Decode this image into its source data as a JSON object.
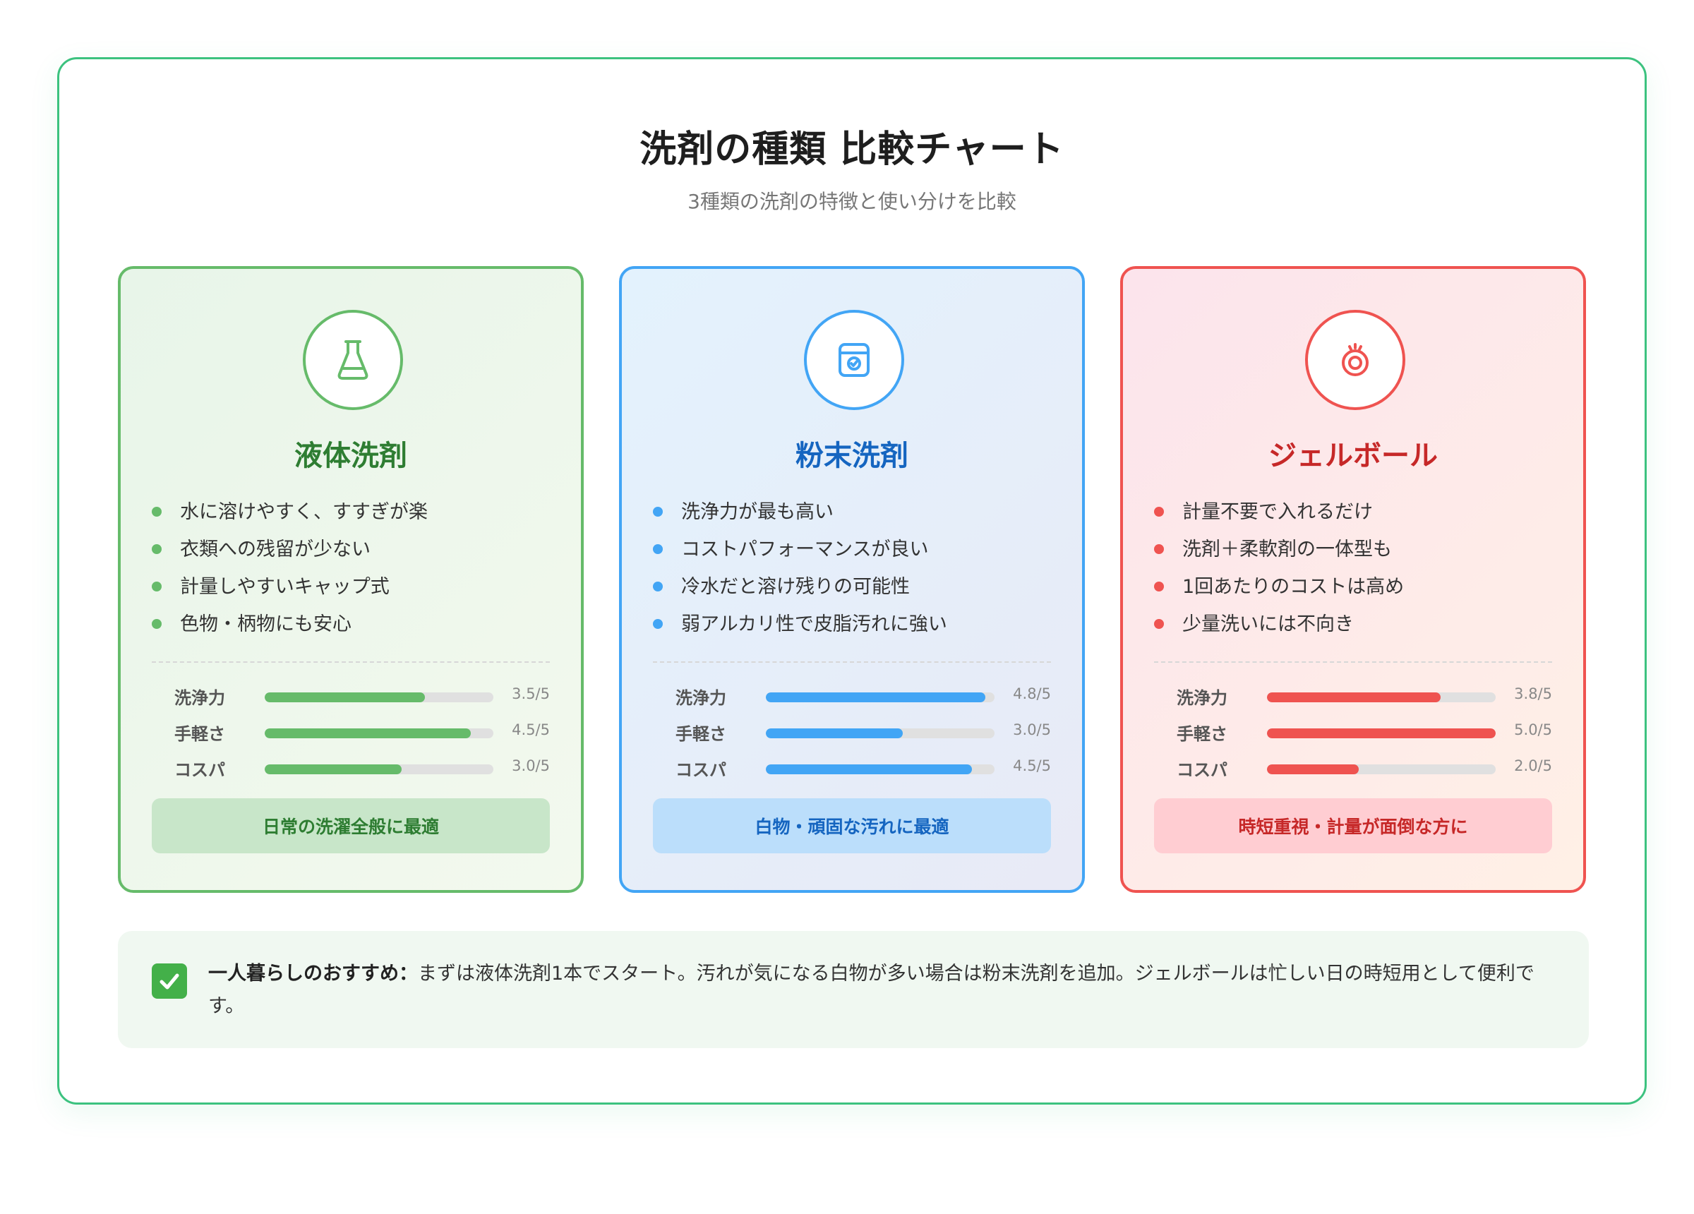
{
  "header": {
    "title": "洗剤の種類 比較チャート",
    "subtitle": "3種類の洗剤の特徴と使い分けを比較"
  },
  "colors": {
    "frame_border": "#3cc27f",
    "green": "#66bb6a",
    "blue": "#42a5f5",
    "red": "#ef5350"
  },
  "cards": [
    {
      "icon": "flask-icon",
      "title": "液体洗剤",
      "features": [
        "水に溶けやすく、すすぎが楽",
        "衣類への残留が少ない",
        "計量しやすいキャップ式",
        "色物・柄物にも安心"
      ],
      "ratings": [
        {
          "label": "洗浄力",
          "value": 3.5,
          "display": "3.5/5"
        },
        {
          "label": "手軽さ",
          "value": 4.5,
          "display": "4.5/5"
        },
        {
          "label": "コスパ",
          "value": 3.0,
          "display": "3.0/5"
        }
      ],
      "badge": "日常の洗濯全般に最適"
    },
    {
      "icon": "detergent-box-icon",
      "title": "粉末洗剤",
      "features": [
        "洗浄力が最も高い",
        "コストパフォーマンスが良い",
        "冷水だと溶け残りの可能性",
        "弱アルカリ性で皮脂汚れに強い"
      ],
      "ratings": [
        {
          "label": "洗浄力",
          "value": 4.8,
          "display": "4.8/5"
        },
        {
          "label": "手軽さ",
          "value": 3.0,
          "display": "3.0/5"
        },
        {
          "label": "コスパ",
          "value": 4.5,
          "display": "4.5/5"
        }
      ],
      "badge": "白物・頑固な汚れに最適"
    },
    {
      "icon": "gel-ball-icon",
      "title": "ジェルボール",
      "features": [
        "計量不要で入れるだけ",
        "洗剤＋柔軟剤の一体型も",
        "1回あたりのコストは高め",
        "少量洗いには不向き"
      ],
      "ratings": [
        {
          "label": "洗浄力",
          "value": 3.8,
          "display": "3.8/5"
        },
        {
          "label": "手軽さ",
          "value": 5.0,
          "display": "5.0/5"
        },
        {
          "label": "コスパ",
          "value": 2.0,
          "display": "2.0/5"
        }
      ],
      "badge": "時短重視・計量が面倒な方に"
    }
  ],
  "recommendation": {
    "icon": "check-mark-icon",
    "label": "一人暮らしのおすすめ：",
    "text": "まずは液体洗剤1本でスタート。汚れが気になる白物が多い場合は粉末洗剤を追加。ジェルボールは忙しい日の時短用として便利です。"
  }
}
